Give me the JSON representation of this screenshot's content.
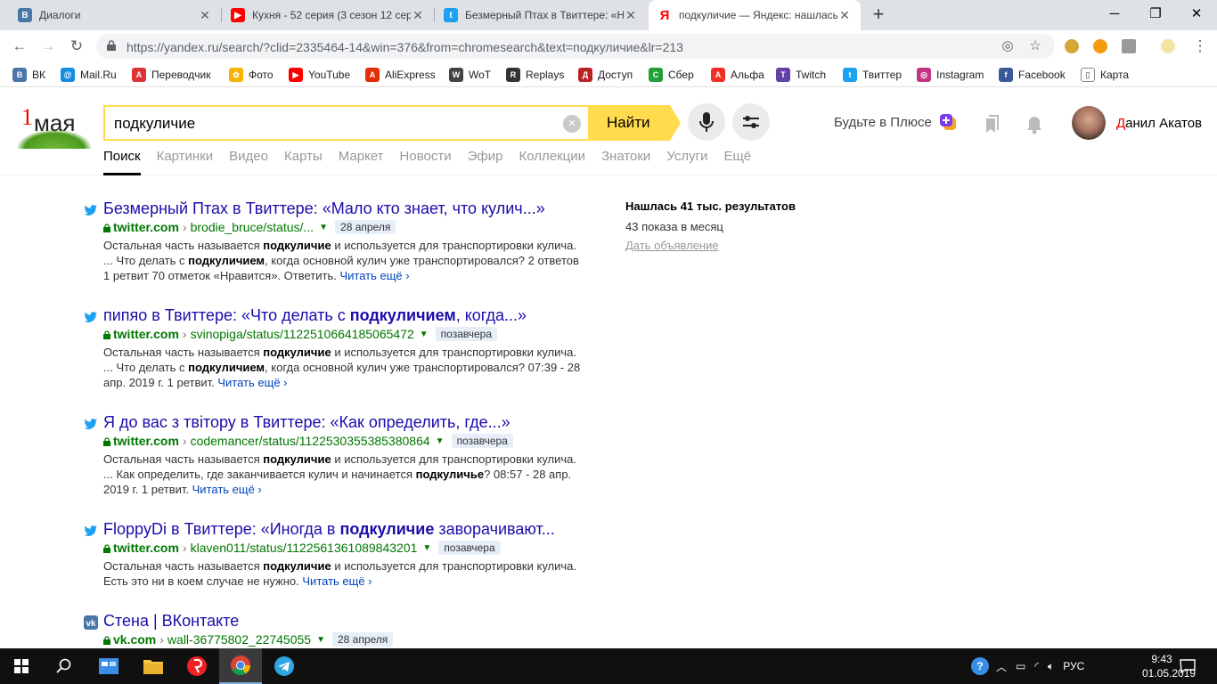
{
  "tabs": [
    {
      "title": "Диалоги",
      "icon": "vk-icon",
      "color": "#4a76a8",
      "glyph": "В"
    },
    {
      "title": "Кухня - 52 серия (3 сезон 12 сер",
      "icon": "youtube-icon",
      "color": "#ff0000",
      "glyph": "▶"
    },
    {
      "title": "Безмерный Птах в Твиттере: «Н",
      "icon": "twitter-icon",
      "color": "#1da1f2",
      "glyph": "t"
    },
    {
      "title": "подкуличие — Яндекс: нашлась",
      "icon": "yandex-icon",
      "color": "#ff0000",
      "glyph": "Я"
    }
  ],
  "address": {
    "url": "https://yandex.ru/search/?clid=2335464-14&win=376&from=chromesearch&text=подкуличие&lr=213"
  },
  "bookmarks": [
    {
      "label": "ВК",
      "icon": "vk-icon",
      "color": "#4a76a8",
      "glyph": "В"
    },
    {
      "label": "Mail.Ru",
      "icon": "mailru-icon",
      "color": "#168de2",
      "glyph": "@"
    },
    {
      "label": "Переводчик",
      "icon": "translator-icon",
      "color": "#d33",
      "glyph": "A"
    },
    {
      "label": "Фото",
      "icon": "photos-icon",
      "color": "#f4b400",
      "glyph": "✿"
    },
    {
      "label": "YouTube",
      "icon": "youtube-icon",
      "color": "#ff0000",
      "glyph": "▶"
    },
    {
      "label": "AliExpress",
      "icon": "aliexpress-icon",
      "color": "#e62e04",
      "glyph": "A"
    },
    {
      "label": "WoT",
      "icon": "wot-icon",
      "color": "#444",
      "glyph": "W"
    },
    {
      "label": "Replays",
      "icon": "replays-icon",
      "color": "#333",
      "glyph": "R"
    },
    {
      "label": "Доступ",
      "icon": "access-icon",
      "color": "#b22",
      "glyph": "Д"
    },
    {
      "label": "Сбер",
      "icon": "sber-icon",
      "color": "#21a038",
      "glyph": "С"
    },
    {
      "label": "Альфа",
      "icon": "alfa-icon",
      "color": "#ef3124",
      "glyph": "A"
    },
    {
      "label": "Twitch",
      "icon": "twitch-icon",
      "color": "#6441a5",
      "glyph": "T"
    },
    {
      "label": "Твиттер",
      "icon": "twitter-icon",
      "color": "#1da1f2",
      "glyph": "t"
    },
    {
      "label": "Instagram",
      "icon": "instagram-icon",
      "color": "#c13584",
      "glyph": "◎"
    },
    {
      "label": "Facebook",
      "icon": "facebook-icon",
      "color": "#3b5998",
      "glyph": "f"
    },
    {
      "label": "Карта",
      "icon": "page-icon",
      "color": "#888",
      "glyph": "▯"
    }
  ],
  "logo": {
    "num": "1",
    "word": "мая"
  },
  "search": {
    "query": "подкуличие",
    "button": "Найти"
  },
  "header": {
    "plus": "Будьте в Плюсе",
    "user_first": "Д",
    "user_rest": "анил Акатов"
  },
  "navtabs": [
    "Поиск",
    "Картинки",
    "Видео",
    "Карты",
    "Маркет",
    "Новости",
    "Эфир",
    "Коллекции",
    "Знатоки",
    "Услуги",
    "Ещё"
  ],
  "results": [
    {
      "icon": "twitter-icon",
      "title_parts": [
        {
          "t": "Безмерный Птах в Твиттере: «Мало кто знает, что кулич...»",
          "b": false
        }
      ],
      "domain": "twitter.com",
      "path": "brodie_bruce/status/...",
      "date": "28 апреля",
      "snippet": [
        {
          "t": "Остальная часть называется ",
          "b": false
        },
        {
          "t": "подкуличие",
          "b": true
        },
        {
          "t": " и используется для транспортировки кулича. ... Что делать с ",
          "b": false
        },
        {
          "t": "подкуличием",
          "b": true
        },
        {
          "t": ", когда основной кулич уже транспортировался? 2 ответов 1 ретвит 70 отметок «Нравится». Ответить. ",
          "b": false
        }
      ],
      "more": "Читать ещё ›"
    },
    {
      "icon": "twitter-icon",
      "title_parts": [
        {
          "t": "пипяо в Твиттере: «Что делать с ",
          "b": false
        },
        {
          "t": "подкуличием",
          "b": true
        },
        {
          "t": ", когда...»",
          "b": false
        }
      ],
      "domain": "twitter.com",
      "path": "svinopiga/status/1122510664185065472",
      "date": "позавчера",
      "snippet": [
        {
          "t": "Остальная часть называется ",
          "b": false
        },
        {
          "t": "подкуличие",
          "b": true
        },
        {
          "t": " и используется для транспортировки кулича. ... Что делать с ",
          "b": false
        },
        {
          "t": "подкуличием",
          "b": true
        },
        {
          "t": ", когда основной кулич уже транспортировался? 07:39 - 28 апр. 2019 г. 1 ретвит. ",
          "b": false
        }
      ],
      "more": "Читать ещё ›"
    },
    {
      "icon": "twitter-icon",
      "title_parts": [
        {
          "t": "Я до вас з твітору в Твиттере: «Как определить, где...»",
          "b": false
        }
      ],
      "domain": "twitter.com",
      "path": "codemancer/status/1122530355385380864",
      "date": "позавчера",
      "snippet": [
        {
          "t": "Остальная часть называется ",
          "b": false
        },
        {
          "t": "подкуличие",
          "b": true
        },
        {
          "t": " и используется для транспортировки кулича. ... Как определить, где заканчивается кулич и начинается ",
          "b": false
        },
        {
          "t": "подкуличье",
          "b": true
        },
        {
          "t": "? 08:57 - 28 апр. 2019 г. 1 ретвит. ",
          "b": false
        }
      ],
      "more": "Читать ещё ›"
    },
    {
      "icon": "twitter-icon",
      "title_parts": [
        {
          "t": "FloppyDi в Твиттере: «Иногда в ",
          "b": false
        },
        {
          "t": "подкуличие",
          "b": true
        },
        {
          "t": " заворачивают...",
          "b": false
        }
      ],
      "domain": "twitter.com",
      "path": "klaven011/status/1122561361089843201",
      "date": "позавчера",
      "snippet": [
        {
          "t": "Остальная часть называется ",
          "b": false
        },
        {
          "t": "подкуличие",
          "b": true
        },
        {
          "t": " и используется для транспортировки кулича. Есть это ни в коем случае не нужно. ",
          "b": false
        }
      ],
      "more": "Читать ещё ›"
    },
    {
      "icon": "vk-icon",
      "title_parts": [
        {
          "t": "Стена | ВКонтакте",
          "b": false
        }
      ],
      "domain": "vk.com",
      "path": "wall-36775802_22745055",
      "date": "28 апреля",
      "snippet": [],
      "more": ""
    }
  ],
  "sidebar": {
    "found": "Нашлась 41 тыс. результатов",
    "shows": "43 показа в месяц",
    "ad": "Дать объявление"
  },
  "taskbar": {
    "lang": "РУС",
    "time": "9:43",
    "date": "01.05.2019"
  }
}
